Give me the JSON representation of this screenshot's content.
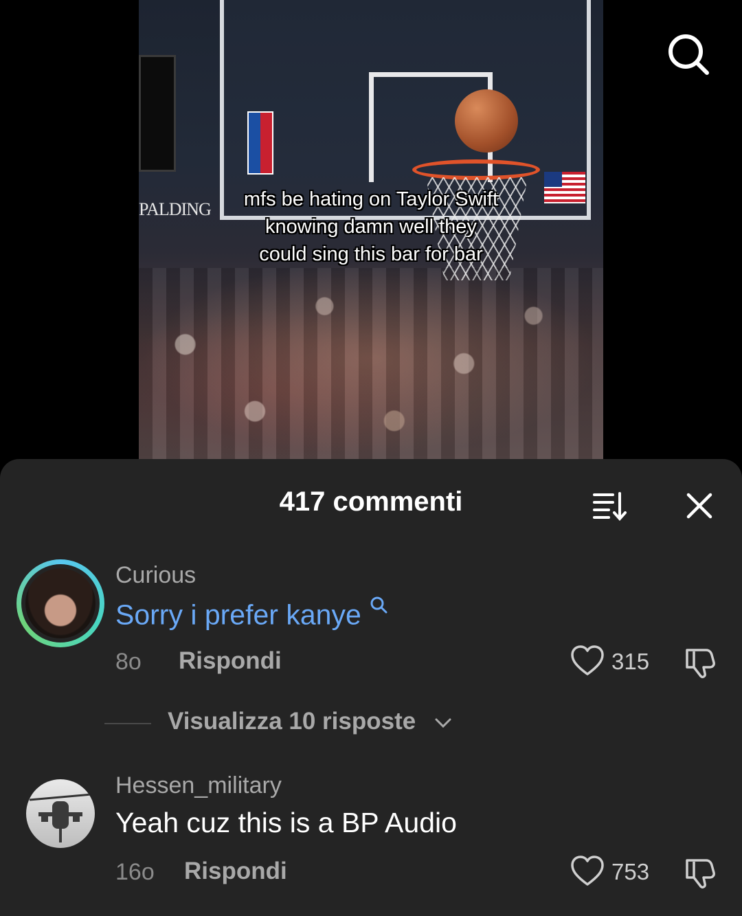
{
  "video": {
    "caption_lines": [
      "mfs be hating on Taylor Swift",
      "knowing damn well they",
      "could sing this bar for bar"
    ],
    "brand_text": "PALDING"
  },
  "comments_sheet": {
    "title": "417 commenti",
    "comments": [
      {
        "username": "Curious",
        "text": "Sorry i prefer kanye",
        "text_is_search_link": true,
        "age": "8o",
        "reply_label": "Rispondi",
        "likes": "315",
        "view_replies_label": "Visualizza 10 risposte"
      },
      {
        "username": "Hessen_military",
        "text": "Yeah cuz this is a BP Audio",
        "age": "16o",
        "reply_label": "Rispondi",
        "likes": "753"
      }
    ]
  },
  "colors": {
    "sheet_bg": "#242424",
    "link_blue": "#6aa9f7",
    "username_gray": "#a9a9a9"
  },
  "icons": [
    "search-icon",
    "sort-icon",
    "close-icon",
    "search-link-icon",
    "heart-icon",
    "dislike-icon",
    "chevron-down-icon"
  ]
}
